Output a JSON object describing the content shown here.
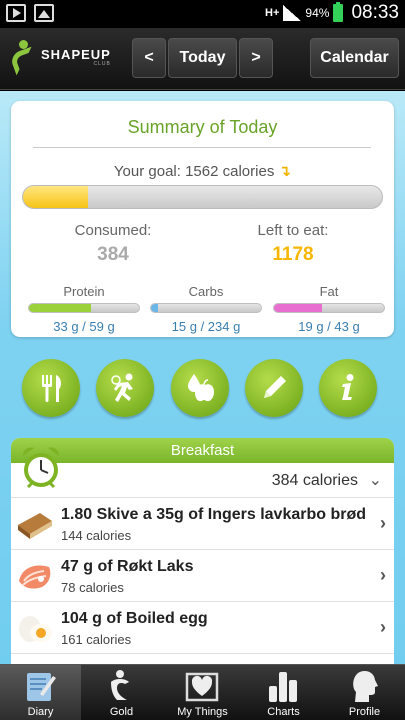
{
  "status_bar": {
    "network": "H+",
    "battery": "94%",
    "time": "08:33",
    "left_icons": [
      "play-store-icon",
      "picture-icon"
    ]
  },
  "header": {
    "logo_text": "SHAPEUP",
    "logo_sub": "CLUB",
    "prev_label": "<",
    "today_label": "Today",
    "next_label": ">",
    "calendar_label": "Calendar"
  },
  "summary": {
    "title": "Summary of Today",
    "goal_text": "Your goal: 1562 calories",
    "goal_progress": 0.18,
    "consumed_label": "Consumed:",
    "consumed_value": "384",
    "left_label": "Left to eat:",
    "left_value": "1178",
    "macros": [
      {
        "label": "Protein",
        "value": "33 g / 59 g",
        "progress": 0.56,
        "color": "#9bd13a"
      },
      {
        "label": "Carbs",
        "value": "15 g / 234 g",
        "progress": 0.06,
        "color": "#6bb6e8"
      },
      {
        "label": "Fat",
        "value": "19 g / 43 g",
        "progress": 0.44,
        "color": "#e86fd0"
      }
    ]
  },
  "actions": [
    {
      "icon": "cutlery-icon"
    },
    {
      "icon": "exercise-icon"
    },
    {
      "icon": "water-apple-icon"
    },
    {
      "icon": "pencil-icon"
    },
    {
      "icon": "info-icon"
    }
  ],
  "meal": {
    "title": "Breakfast",
    "calories": "384 calories",
    "items": [
      {
        "name": "1.80 Skive a 35g of Ingers lavkarbo brød",
        "calories": "144 calories",
        "icon": "bread-icon"
      },
      {
        "name": "47 g of Røkt Laks",
        "calories": "78 calories",
        "icon": "salmon-icon"
      },
      {
        "name": "104 g of Boiled egg",
        "calories": "161 calories",
        "icon": "egg-icon"
      }
    ]
  },
  "tabs": [
    {
      "label": "Diary",
      "icon": "diary-icon",
      "active": true
    },
    {
      "label": "Gold",
      "icon": "gold-icon",
      "active": false
    },
    {
      "label": "My Things",
      "icon": "heart-box-icon",
      "active": false
    },
    {
      "label": "Charts",
      "icon": "bar-chart-icon",
      "active": false
    },
    {
      "label": "Profile",
      "icon": "profile-icon",
      "active": false
    }
  ],
  "colors": {
    "accent_green": "#7eb324",
    "goal_yellow": "#f6c417",
    "background_blue": "#7fd2f1"
  }
}
